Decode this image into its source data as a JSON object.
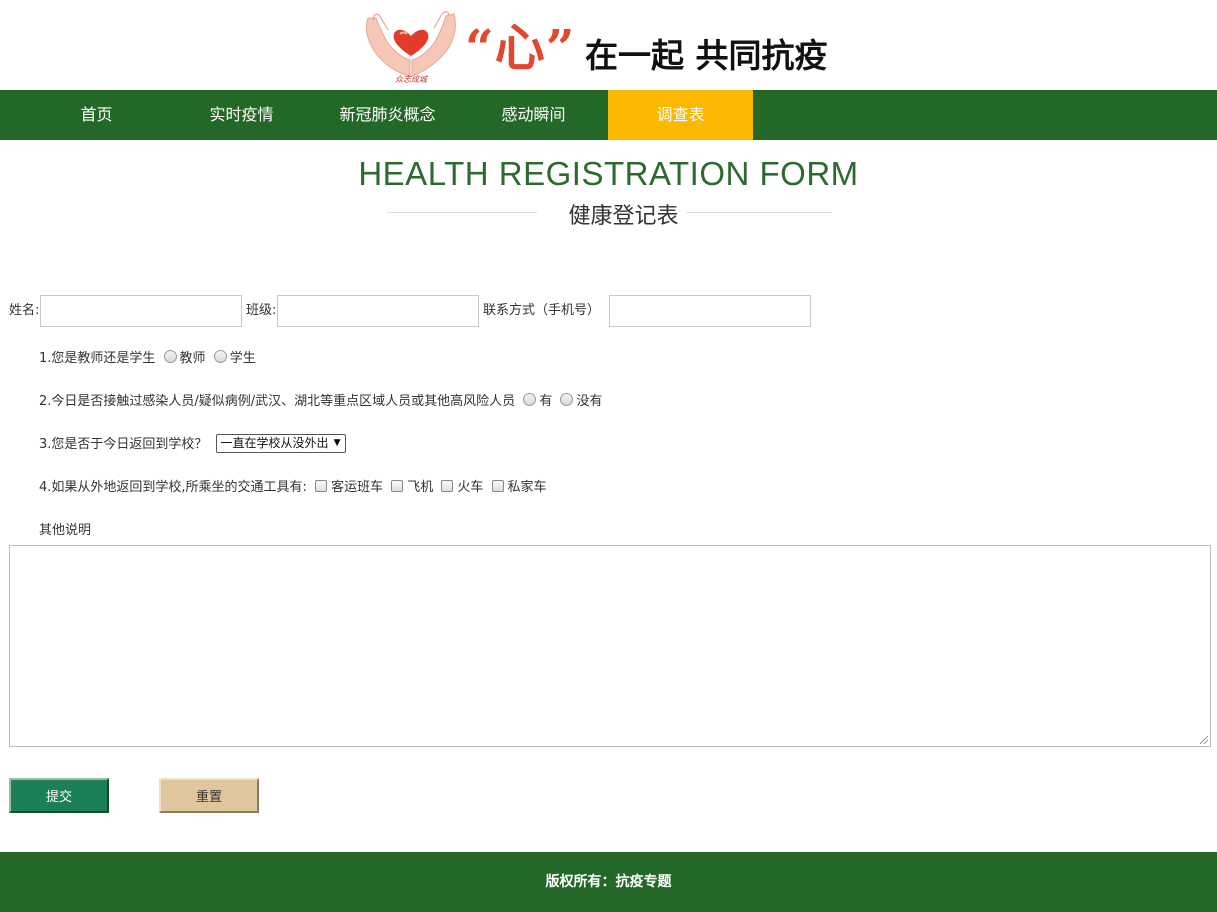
{
  "header": {
    "logo_small_text": "众志成城",
    "logo_xin": "“心”",
    "slogan": "在一起 共同抗疫"
  },
  "nav": {
    "items": [
      {
        "label": "首页"
      },
      {
        "label": "实时疫情"
      },
      {
        "label": "新冠肺炎概念"
      },
      {
        "label": "感动瞬间"
      },
      {
        "label": "调查表"
      }
    ],
    "active_index": 4
  },
  "title": {
    "en": "HEALTH REGISTRATION FORM",
    "cn": "健康登记表"
  },
  "form": {
    "name_label": "姓名:",
    "name_value": "",
    "class_label": "班级:",
    "class_value": "",
    "phone_label": "联系方式（手机号）",
    "phone_value": "",
    "q1": {
      "text": "1.您是教师还是学生",
      "options": [
        "教师",
        "学生"
      ]
    },
    "q2": {
      "text": "2.今日是否接触过感染人员/疑似病例/武汉、湖北等重点区域人员或其他高风险人员",
      "options": [
        "有",
        "没有"
      ]
    },
    "q3": {
      "text": "3.您是否于今日返回到学校？",
      "selected": "一直在学校从没外出"
    },
    "q4": {
      "text": "4.如果从外地返回到学校,所乘坐的交通工具有:",
      "options": [
        "客运班车",
        "飞机",
        "火车",
        "私家车"
      ]
    },
    "other_label": "其他说明",
    "other_value": "",
    "submit_label": "提交",
    "reset_label": "重置"
  },
  "footer": {
    "text": "版权所有：抗疫专题"
  },
  "colors": {
    "nav_bg": "#236827",
    "nav_active": "#fbb800",
    "title_green": "#2c6a2f",
    "submit_bg": "#1d8055",
    "reset_bg": "#dfc69c",
    "logo_red": "#e0492f"
  }
}
